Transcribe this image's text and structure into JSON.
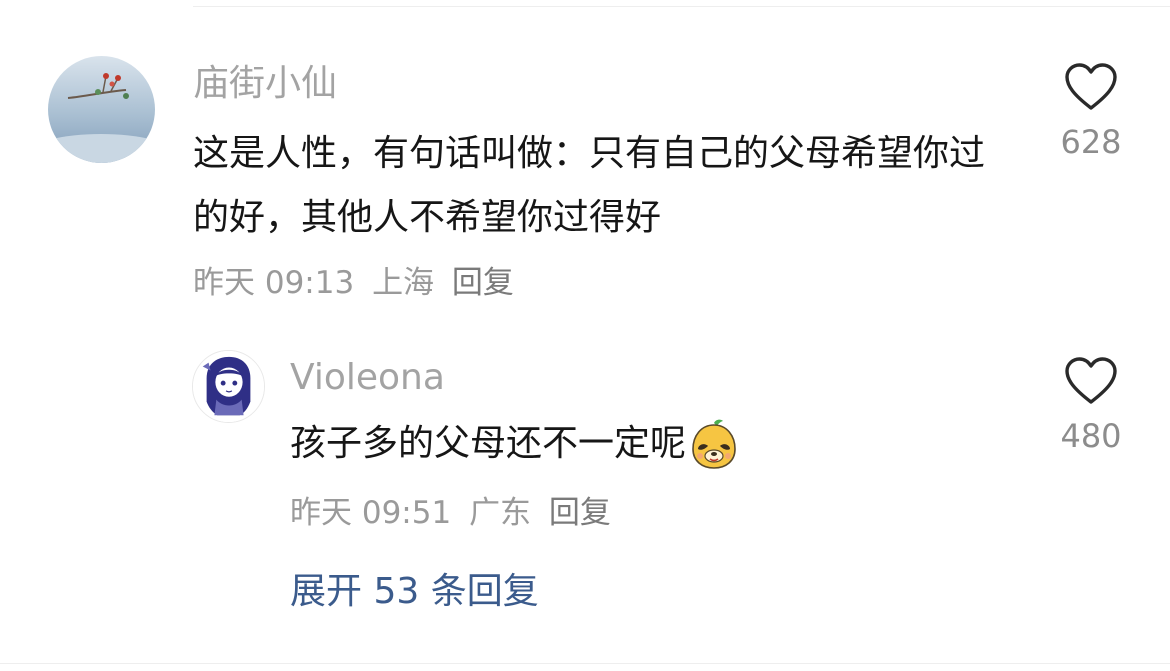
{
  "comments": [
    {
      "username": "庙街小仙",
      "text": "这是人性，有句话叫做：只有自己的父母希望你过的好，其他人不希望你过得好",
      "time": "昨天 09:13",
      "location": "上海",
      "reply_label": "回复",
      "likes": "628",
      "avatar_icon": "winter-branch-avatar"
    },
    {
      "username": "Violeona",
      "text": "孩子多的父母还不一定呢",
      "time": "昨天 09:51",
      "location": "广东",
      "reply_label": "回复",
      "likes": "480",
      "avatar_icon": "anime-girl-avatar",
      "emoji_icon": "smiling-pear-emoji"
    }
  ],
  "expand_label": "展开 53 条回复",
  "colors": {
    "username": "#a3a3a3",
    "text": "#161616",
    "meta": "#9a9a9a",
    "link": "#3b5b8c"
  }
}
